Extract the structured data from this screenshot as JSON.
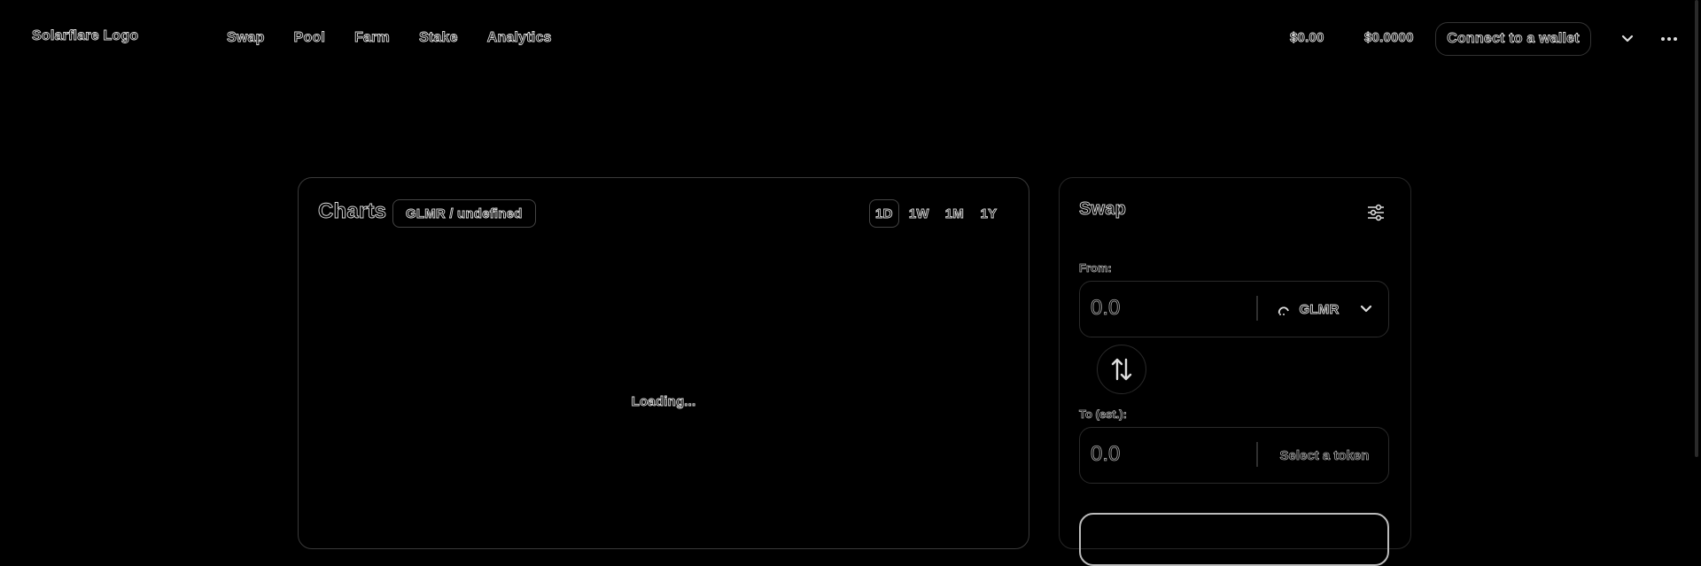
{
  "header": {
    "logo_text": "Solarflare Logo",
    "nav": [
      "Swap",
      "Pool",
      "Farm",
      "Stake",
      "Analytics"
    ],
    "price_primary": "$0.00",
    "price_secondary": "$0.0000",
    "connect_label": "Connect to a wallet"
  },
  "charts": {
    "title": "Charts",
    "pair": "GLMR / undefined",
    "ranges": [
      "1D",
      "1W",
      "1M",
      "1Y"
    ],
    "active_range": "1D",
    "loading_text": "Loading..."
  },
  "swap": {
    "title": "Swap",
    "from_label": "From:",
    "from_amount": "0.0",
    "from_token": "GLMR",
    "to_label": "To (est.):",
    "to_amount": "0.0",
    "to_token_placeholder": "Select a token"
  },
  "icons": {
    "settings": "sliders-icon",
    "chevron": "chevron-down-icon",
    "more": "more-horizontal-icon",
    "swap_direction": "arrows-up-down-icon",
    "token": "glmr-token-icon"
  },
  "colors": {
    "background": "#000000",
    "text_outline": "#dddddd",
    "border": "#333333"
  }
}
